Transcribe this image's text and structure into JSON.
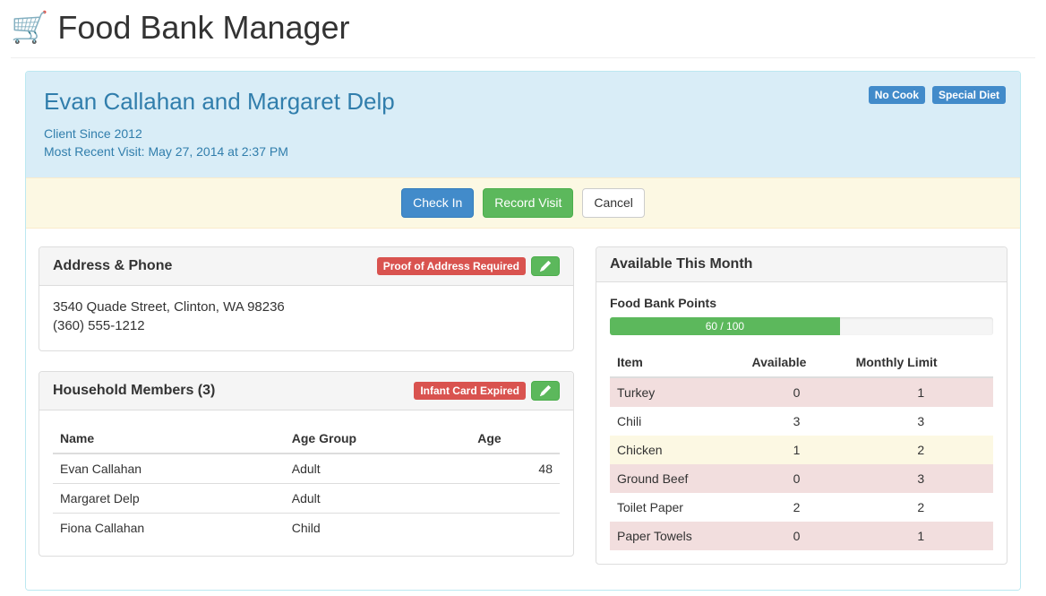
{
  "app": {
    "title": "Food Bank Manager",
    "icon": "🛒"
  },
  "client": {
    "name": "Evan Callahan and Margaret Delp",
    "since_label": "Client Since 2012",
    "recent_label": "Most Recent Visit: ",
    "recent_value": "May 27, 2014 at 2:37 PM",
    "badges": [
      "No Cook",
      "Special Diet"
    ]
  },
  "actions": {
    "check_in": "Check In",
    "record_visit": "Record Visit",
    "cancel": "Cancel"
  },
  "address_panel": {
    "title": "Address & Phone",
    "warning": "Proof of Address Required",
    "address": "3540 Quade Street, Clinton, WA 98236",
    "phone": "(360) 555-1212"
  },
  "household_panel": {
    "title": "Household Members (3)",
    "warning": "Infant Card Expired",
    "columns": {
      "name": "Name",
      "age_group": "Age Group",
      "age": "Age"
    },
    "members": [
      {
        "name": "Evan Callahan",
        "age_group": "Adult",
        "age": "48"
      },
      {
        "name": "Margaret Delp",
        "age_group": "Adult",
        "age": ""
      },
      {
        "name": "Fiona Callahan",
        "age_group": "Child",
        "age": ""
      }
    ]
  },
  "available_panel": {
    "title": "Available This Month",
    "points_label": "Food Bank Points",
    "points_text": "60 / 100",
    "points_pct": 60,
    "columns": {
      "item": "Item",
      "available": "Available",
      "limit": "Monthly Limit"
    },
    "items": [
      {
        "name": "Turkey",
        "available": "0",
        "limit": "1",
        "status": "danger"
      },
      {
        "name": "Chili",
        "available": "3",
        "limit": "3",
        "status": ""
      },
      {
        "name": "Chicken",
        "available": "1",
        "limit": "2",
        "status": "warning"
      },
      {
        "name": "Ground Beef",
        "available": "0",
        "limit": "3",
        "status": "danger"
      },
      {
        "name": "Toilet Paper",
        "available": "2",
        "limit": "2",
        "status": ""
      },
      {
        "name": "Paper Towels",
        "available": "0",
        "limit": "1",
        "status": "danger"
      }
    ]
  }
}
